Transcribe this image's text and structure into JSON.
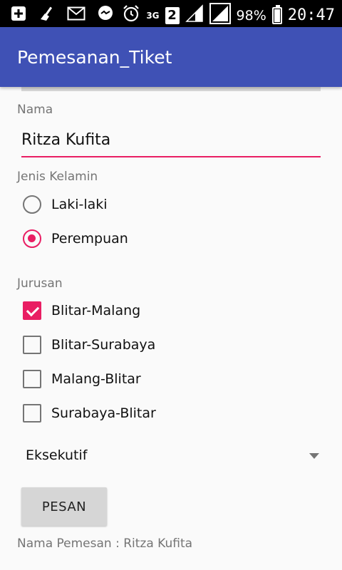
{
  "status_bar": {
    "icons": [
      "add-box-icon",
      "broom-icon",
      "mail-icon",
      "chat-icon",
      "alarm-icon",
      "3g-icon",
      "sim-2-icon",
      "signal-icon",
      "signal-icon",
      "battery-icon"
    ],
    "network_label": "3G",
    "sim_label": "2",
    "battery": "98%",
    "battery_level": 0.98,
    "time": "20:47"
  },
  "app_bar": {
    "title": "Pemesanan_Tiket",
    "color": "#3f51b5"
  },
  "form": {
    "nama_label": "Nama",
    "nama_value": "Ritza Kufita",
    "gender_label": "Jenis Kelamin",
    "gender_options": [
      {
        "label": "Laki-laki",
        "checked": false
      },
      {
        "label": "Perempuan",
        "checked": true
      }
    ],
    "jurusan_label": "Jurusan",
    "jurusan_options": [
      {
        "label": "Blitar-Malang",
        "checked": true
      },
      {
        "label": "Blitar-Surabaya",
        "checked": false
      },
      {
        "label": "Malang-Blitar",
        "checked": false
      },
      {
        "label": "Surabaya-Blitar",
        "checked": false
      }
    ],
    "class_selected": "Eksekutif",
    "submit_label": "PESAN",
    "result_text": "Nama Pemesan : Ritza Kufita",
    "accent_color": "#e91e63"
  }
}
